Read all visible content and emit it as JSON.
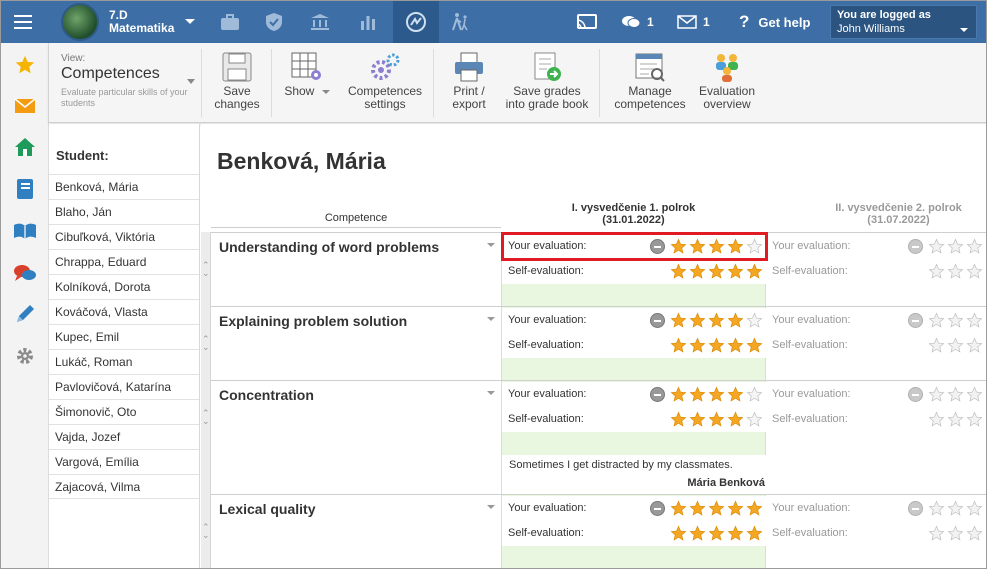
{
  "topbar": {
    "class_name": "7.D",
    "subject": "Matematika",
    "messages_count": "1",
    "mail_count": "1",
    "help_label": "Get help",
    "logged_label": "You are logged as",
    "user_name": "John Williams"
  },
  "toolbar": {
    "view_label": "View:",
    "view_title": "Competences",
    "view_desc": "Evaluate particular skills of your students",
    "buttons": {
      "save": "Save changes",
      "show": "Show",
      "comp_settings": "Competences settings",
      "print": "Print / export",
      "save_grades": "Save grades into grade book",
      "manage": "Manage competences",
      "overview": "Evaluation overview"
    }
  },
  "students": {
    "header": "Student:",
    "list": [
      "Benková, Mária",
      "Blaho, Ján",
      "Cibuľková, Viktória",
      "Chrappa, Eduard",
      "Kolníková, Dorota",
      "Kováčová, Vlasta",
      "Kupec, Emil",
      "Lukáč, Roman",
      "Pavlovičová, Katarína",
      "Šimonovič, Oto",
      "Vajda, Jozef",
      "Vargová, Emília",
      "Zajacová, Vilma"
    ]
  },
  "main": {
    "student_name": "Benková, Mária",
    "competence_header": "Competence",
    "period1": {
      "title": "I. vysvedčenie 1. polrok",
      "date": "(31.01.2022)"
    },
    "period2": {
      "title": "II. vysvedčenie 2. polrok",
      "date": "(31.07.2022)"
    },
    "your_eval_label": "Your evaluation:",
    "self_eval_label": "Self-evaluation:",
    "competences": [
      {
        "name": "Understanding of word problems",
        "your": 4,
        "self": 5
      },
      {
        "name": "Explaining problem solution",
        "your": 4,
        "self": 5
      },
      {
        "name": "Concentration",
        "your": 4,
        "self": 4,
        "comment": "Sometimes I get distracted by my classmates.",
        "author": "Mária Benková"
      },
      {
        "name": "Lexical quality",
        "your": 5,
        "self": 5
      }
    ]
  },
  "colors": {
    "topbar": "#3d6ea5",
    "star": "#f5a623",
    "eval_bg": "#eaf7e0",
    "highlight": "#e01b24"
  }
}
